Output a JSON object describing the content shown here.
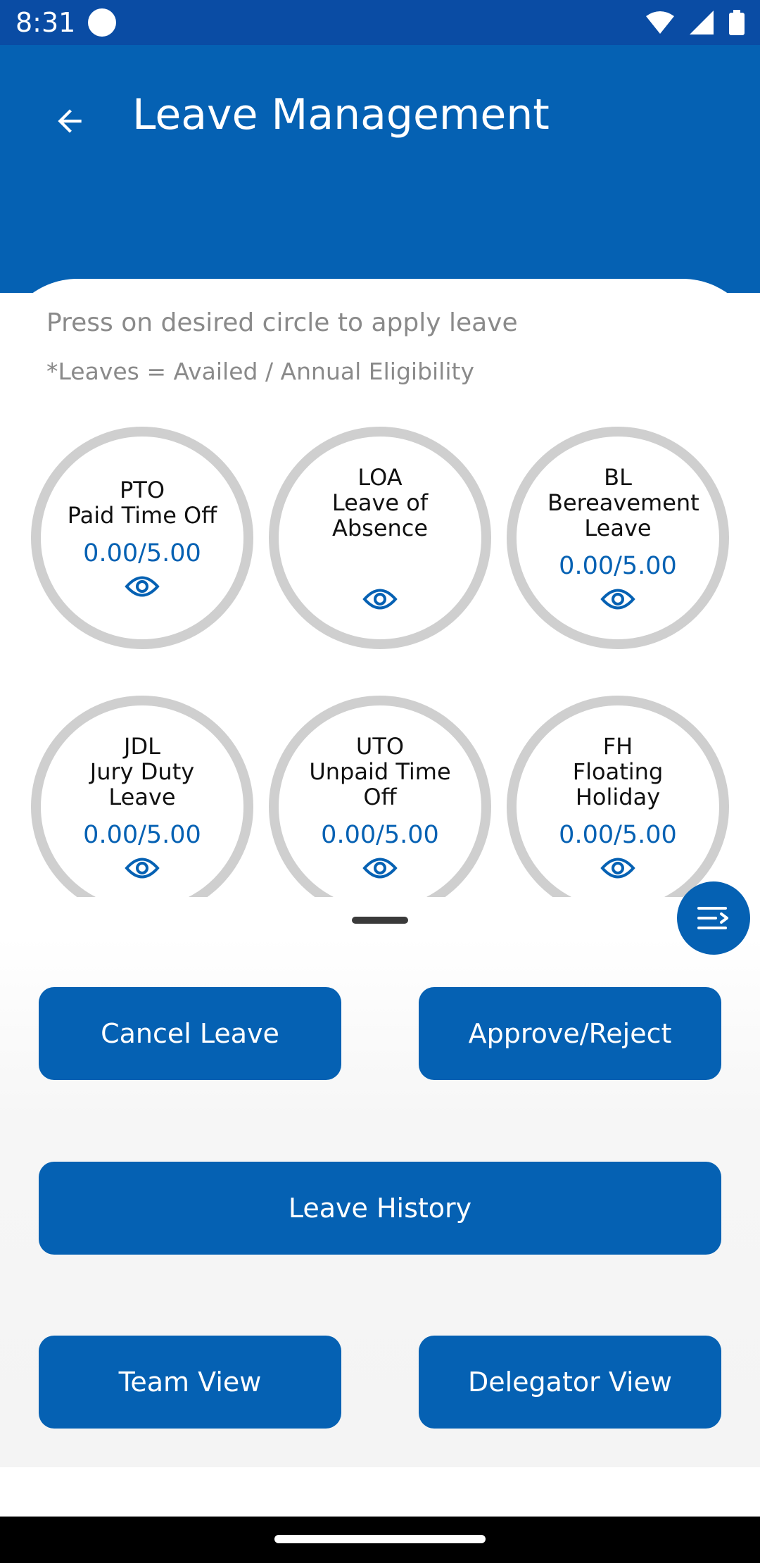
{
  "status_bar": {
    "time": "8:31"
  },
  "header": {
    "title": "Leave Management"
  },
  "instructions": {
    "line1": "Press on desired circle to apply leave",
    "line2": "*Leaves = Availed / Annual Eligibility"
  },
  "leaves": [
    {
      "code": "PTO",
      "name": "Paid Time Off",
      "balance": "0.00/5.00"
    },
    {
      "code": "LOA",
      "name": "Leave of Absence",
      "balance": ""
    },
    {
      "code": "BL",
      "name": "Bereavement Leave",
      "balance": "0.00/5.00"
    },
    {
      "code": "JDL",
      "name": "Jury Duty Leave",
      "balance": "0.00/5.00"
    },
    {
      "code": "UTO",
      "name": "Unpaid Time Off",
      "balance": "0.00/5.00"
    },
    {
      "code": "FH",
      "name": "Floating Holiday",
      "balance": "0.00/5.00"
    }
  ],
  "actions": {
    "cancel_leave": "Cancel Leave",
    "approve_reject": "Approve/Reject",
    "leave_history": "Leave History",
    "team_view": "Team View",
    "delegator_view": "Delegator View"
  },
  "colors": {
    "primary": "#0561B3",
    "status_bar": "#0A4CA4",
    "circle_border": "#CFCFCF"
  },
  "icons": {
    "back": "arrow-left-icon",
    "view": "eye-icon",
    "fab": "menu-list-icon"
  }
}
